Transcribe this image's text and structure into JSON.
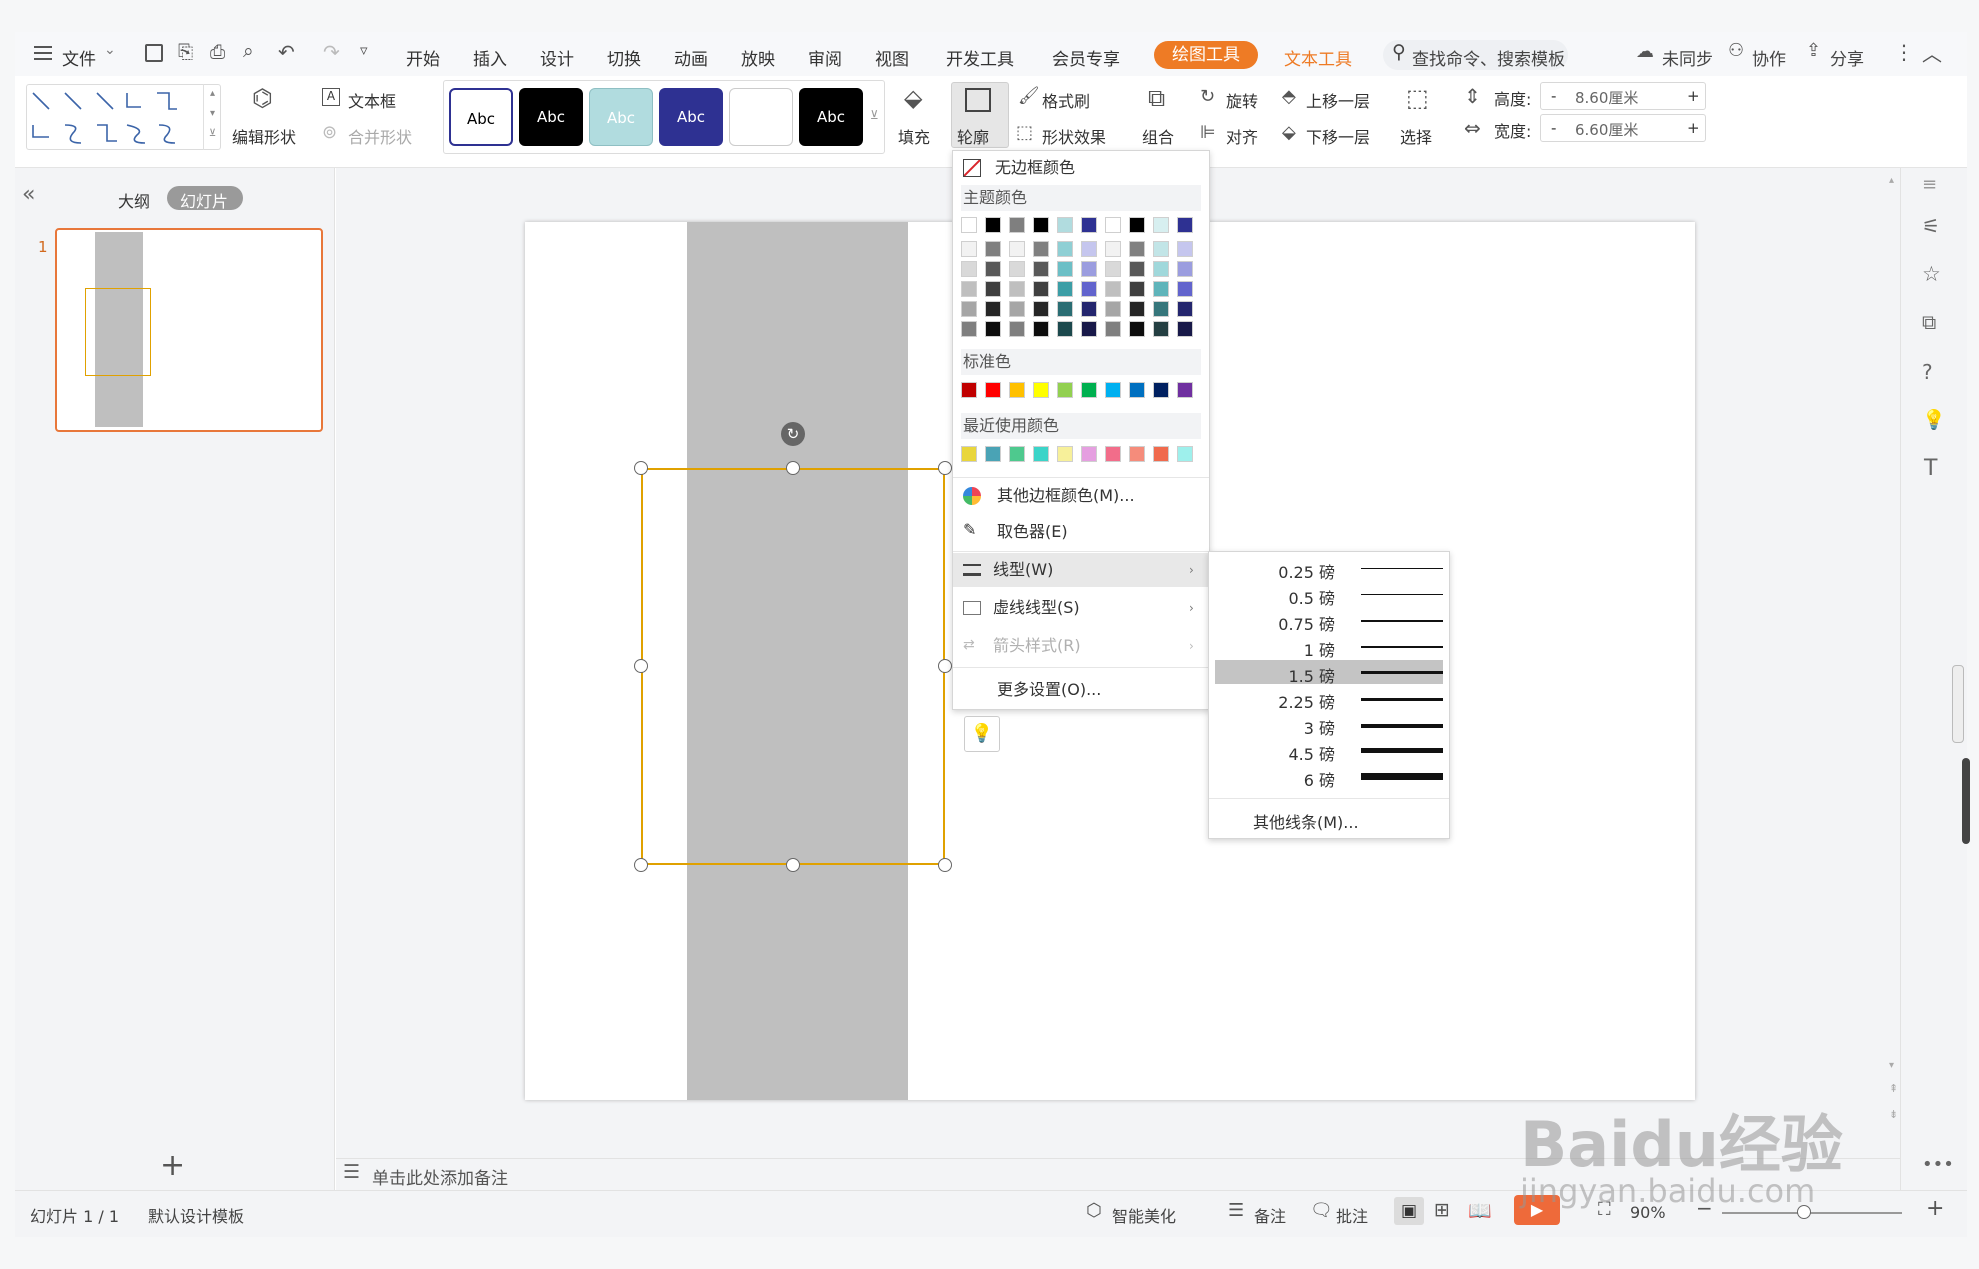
{
  "menubar": {
    "file": "文件",
    "tabs": [
      "开始",
      "插入",
      "设计",
      "切换",
      "动画",
      "放映",
      "审阅",
      "视图",
      "开发工具",
      "会员专享"
    ],
    "context_active": "绘图工具",
    "context_other": "文本工具",
    "search": "查找命令、搜索模板",
    "sync": "未同步",
    "collab": "协作",
    "share": "分享"
  },
  "ribbon": {
    "edit_shape": "编辑形状",
    "textbox": "文本框",
    "merge_shape": "合并形状",
    "style_label": "Abc",
    "fill": "填充",
    "outline": "轮廓",
    "format_painter": "格式刷",
    "shape_effect": "形状效果",
    "group": "组合",
    "rotate": "旋转",
    "align": "对齐",
    "bring_forward": "上移一层",
    "send_backward": "下移一层",
    "select": "选择",
    "height_label": "高度:",
    "height_value": "8.60厘米",
    "width_label": "宽度:",
    "width_value": "6.60厘米",
    "minus": "-",
    "plus": "+"
  },
  "left_panel": {
    "outline_tab": "大纲",
    "slides_tab": "幻灯片",
    "slide_num": "1",
    "collapse": "«",
    "add": "+"
  },
  "notes_placeholder": "单击此处添加备注",
  "outline_menu": {
    "no_border": "无边框颜色",
    "theme_colors": "主题颜色",
    "standard_colors": "标准色",
    "recent_colors": "最近使用颜色",
    "more_colors": "其他边框颜色(M)...",
    "eyedropper": "取色器(E)",
    "line_type": "线型(W)",
    "dash_type": "虚线线型(S)",
    "arrow_style": "箭头样式(R)",
    "more_settings": "更多设置(O)...",
    "theme_top": [
      "#ffffff",
      "#000000",
      "#7f7f7f",
      "#000000",
      "#b1dcdf",
      "#2e3192",
      "#ffffff",
      "#000000",
      "#d7eff0",
      "#2e3192"
    ],
    "theme_shades": [
      [
        "#f2f2f2",
        "#7f7f7f",
        "#f2f2f2",
        "#808080",
        "#8fcfd4",
        "#c5c6ee",
        "#f2f2f2",
        "#808080",
        "#c2e5e7",
        "#c5c6ee"
      ],
      [
        "#d9d9d9",
        "#595959",
        "#d9d9d9",
        "#595959",
        "#6cbfc6",
        "#9b9ddf",
        "#d9d9d9",
        "#595959",
        "#a0d8db",
        "#9b9ddf"
      ],
      [
        "#bfbfbf",
        "#3f3f3f",
        "#bfbfbf",
        "#404040",
        "#3c9ea6",
        "#6264cd",
        "#bfbfbf",
        "#404040",
        "#5fb4ba",
        "#6264cd"
      ],
      [
        "#a6a6a6",
        "#262626",
        "#a6a6a6",
        "#262626",
        "#2a6d73",
        "#24266e",
        "#a6a6a6",
        "#262626",
        "#36767b",
        "#24266e"
      ],
      [
        "#7f7f7f",
        "#0d0d0d",
        "#7f7f7f",
        "#0d0d0d",
        "#1c494d",
        "#181949",
        "#7f7f7f",
        "#0d0d0d",
        "#243f42",
        "#181949"
      ]
    ],
    "standard": [
      "#c00000",
      "#ff0000",
      "#ffc000",
      "#ffff00",
      "#92d050",
      "#00b050",
      "#00b0f0",
      "#0070c0",
      "#002060",
      "#7030a0"
    ],
    "recent": [
      "#e9d63c",
      "#4aa3b5",
      "#4ec98e",
      "#3bd4c8",
      "#f7f09a",
      "#e59fe0",
      "#f26d8a",
      "#f58c7b",
      "#f06a4d",
      "#9ef0ec"
    ]
  },
  "line_weights": {
    "items": [
      "0.25 磅",
      "0.5 磅",
      "0.75 磅",
      "1 磅",
      "1.5 磅",
      "2.25 磅",
      "3 磅",
      "4.5 磅",
      "6 磅"
    ],
    "selected": "1.5 磅",
    "more_lines": "其他线条(M)..."
  },
  "statusbar": {
    "slide_count": "幻灯片 1 / 1",
    "template": "默认设计模板",
    "beautify": "智能美化",
    "notes": "备注",
    "comments": "批注",
    "zoom": "90%"
  },
  "watermark": {
    "brand": "Baidu经验",
    "url": "jingyan.baidu.com"
  },
  "colors": {
    "accent": "#ee7b25",
    "selection": "#e0a100",
    "gray_rect": "#bfbfbf"
  }
}
